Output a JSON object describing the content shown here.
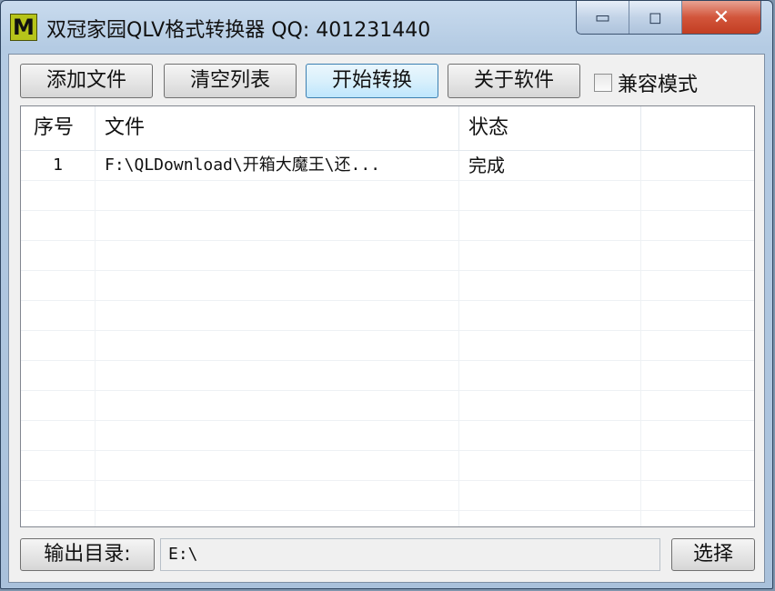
{
  "window": {
    "title": "双冠家园QLV格式转换器 QQ: 401231440",
    "logo_letter": "M",
    "minimize_glyph": "▭",
    "maximize_glyph": "◻",
    "close_glyph": "✕"
  },
  "toolbar": {
    "add_files": "添加文件",
    "clear_list": "清空列表",
    "start_convert": "开始转换",
    "about": "关于软件",
    "compat_mode": "兼容模式",
    "compat_mode_checked": false
  },
  "list": {
    "columns": [
      "序号",
      "文件",
      "状态",
      ""
    ],
    "rows": [
      {
        "index": "1",
        "file": "F:\\QLDownload\\开箱大魔王\\还...",
        "status": "完成",
        "extra": ""
      }
    ]
  },
  "output": {
    "label": "输出目录:",
    "path": "E:\\",
    "choose": "选择"
  },
  "colors": {
    "titlebar": "#b4cbe3",
    "close_button": "#c8432a",
    "active_button": "#bee6fd",
    "logo": "#b6c41a"
  }
}
